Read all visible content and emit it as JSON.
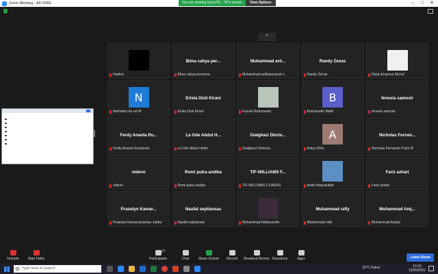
{
  "window": {
    "title": "Zoom Meeting - A4-VR65"
  },
  "banner": {
    "viewing": "You are viewing Ircan.PG - TIF's screen",
    "view_options": "View Options"
  },
  "tiles": [
    {
      "name": "",
      "foot": "Haekal",
      "avatar": "",
      "avatar_color": "#000000"
    },
    {
      "name": "Bima cahya per...",
      "foot": "Bima cahya permana",
      "avatar": "",
      "avatar_color": ""
    },
    {
      "name": "Muhammad ard...",
      "foot": "Muhammad ardhiyansyah n",
      "avatar": "",
      "avatar_color": ""
    },
    {
      "name": "Randy Zenas",
      "foot": "Randy Zenas",
      "avatar": "",
      "avatar_color": ""
    },
    {
      "name": "",
      "foot": "Rizqi arhannur Ma'ruf",
      "avatar": "",
      "avatar_color": "#f0f0f0"
    },
    {
      "name": "",
      "foot": "Nurhakim Az-ad W",
      "avatar": "N",
      "avatar_color": "#1e7bd6"
    },
    {
      "name": "Erista Disti Kirani",
      "foot": "Erista Disti Kirani",
      "avatar": "",
      "avatar_color": ""
    },
    {
      "name": "",
      "foot": "Fazrah Rahmawati",
      "avatar": "",
      "avatar_color": "#b9c4bb"
    },
    {
      "name": "",
      "foot": "Burhanudin Malik",
      "avatar": "B",
      "avatar_color": "#5a5fc9"
    },
    {
      "name": "fenesia samosir",
      "foot": "fenesia samosir",
      "avatar": "",
      "avatar_color": ""
    },
    {
      "name": "Ferdy Ananta Ru...",
      "foot": "Ferdy Ananta Rusdianto",
      "avatar": "",
      "avatar_color": ""
    },
    {
      "name": "La Ode Abdul H...",
      "foot": "La Ode Abdul Halim",
      "avatar": "",
      "avatar_color": ""
    },
    {
      "name": "Gialghazi Diorio...",
      "foot": "Gialghazi Dioriona",
      "avatar": "",
      "avatar_color": ""
    },
    {
      "name": "",
      "foot": "Ardya Wira",
      "avatar": "A",
      "avatar_color": "#9c7b73"
    },
    {
      "name": "Nicholas Fernan...",
      "foot": "Nicholas Fernando Putra M",
      "avatar": "",
      "avatar_color": ""
    },
    {
      "name": "oldeno",
      "foot": "oldeno",
      "avatar": "",
      "avatar_color": ""
    },
    {
      "name": "Romi putra andika",
      "foot": "Romi putra andika",
      "avatar": "",
      "avatar_color": ""
    },
    {
      "name": "TIF-WILLIAMS F...",
      "foot": "TIF-WILLIAMS F DAENG",
      "avatar": "",
      "avatar_color": ""
    },
    {
      "name": "",
      "foot": "dwiki hidayatullah",
      "avatar": "",
      "avatar_color": "#5c8fc4"
    },
    {
      "name": "Fariz azhari",
      "foot": "Fariz azhari",
      "avatar": "",
      "avatar_color": ""
    },
    {
      "name": "Prasetyo Kamar...",
      "foot": "Prasetyo Kamaruzzaman Jabba",
      "avatar": "",
      "avatar_color": ""
    },
    {
      "name": "Naufal septiansas",
      "foot": "Naufal septiansas",
      "avatar": "",
      "avatar_color": ""
    },
    {
      "name": "",
      "foot": "Muhammad Addarunafis",
      "avatar": "",
      "avatar_color": "#3a2a3a"
    },
    {
      "name": "Muhammad rafly",
      "foot": "Muhammad rafly",
      "avatar": "",
      "avatar_color": ""
    },
    {
      "name": "Mohammad Amj...",
      "foot": "Muhammad Amjad",
      "avatar": "",
      "avatar_color": ""
    }
  ],
  "toolbar": {
    "unmute": "Unmute",
    "start_video": "Start Video",
    "participants": "Participants",
    "participants_count": "27",
    "chat": "Chat",
    "share_screen": "Share Screen",
    "record": "Record",
    "breakout": "Breakout Rooms",
    "reactions": "Reactions",
    "apps": "Apps",
    "leave": "Leave Room"
  },
  "taskbar": {
    "search_placeholder": "Type here to search",
    "weather": "32°C Kabut",
    "time": "10:33",
    "date": "10/05/2022"
  }
}
